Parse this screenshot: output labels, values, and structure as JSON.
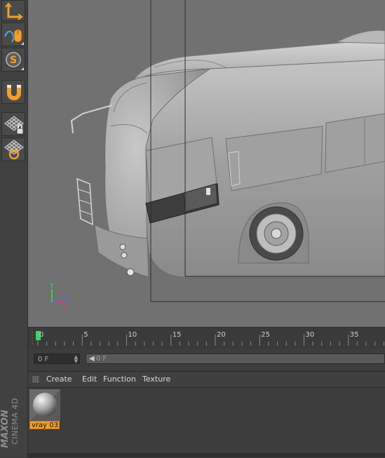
{
  "toolbar": {
    "tools": [
      {
        "icon": "axis-icon",
        "active": true
      },
      {
        "icon": "mouse-brush-icon"
      },
      {
        "icon": "snap-s-icon"
      },
      {
        "icon": "magnet-icon"
      },
      {
        "icon": "grid-lock-icon"
      },
      {
        "icon": "grid-refresh-icon"
      }
    ]
  },
  "brand": {
    "maxon": "MAXON",
    "product": "CINEMA 4D"
  },
  "viewport": {
    "axis": {
      "y": "Y",
      "z": "Z",
      "x": "X"
    }
  },
  "timeline": {
    "start_frame": 0,
    "tick_labels": [
      "0",
      "5",
      "10",
      "15",
      "20",
      "25",
      "30",
      "35"
    ],
    "current_frame": 0
  },
  "frame_bar": {
    "current_value": "0 F",
    "slider_value": "0 F"
  },
  "material_manager": {
    "menus": [
      "Create",
      "Edit",
      "Function",
      "Texture"
    ],
    "materials": [
      {
        "name": "vray 03",
        "selected": true
      }
    ]
  },
  "colors": {
    "accent": "#f0a030",
    "timeline_marker": "#3ed36a",
    "viewport_bg": "#717171"
  }
}
